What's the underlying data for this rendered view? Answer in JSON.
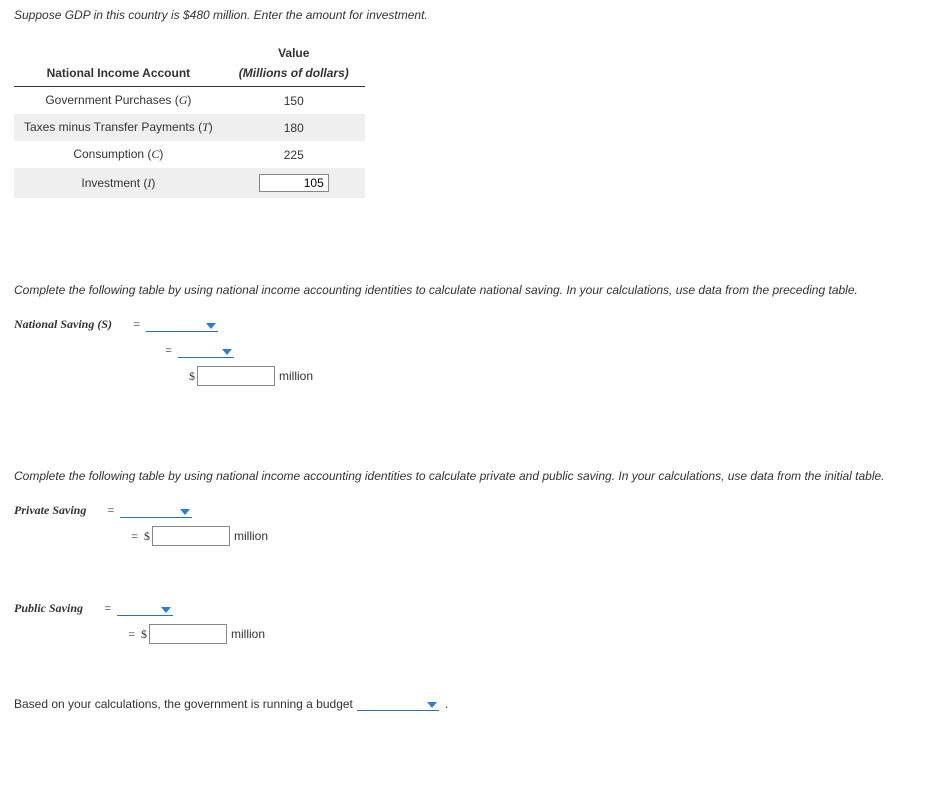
{
  "intro": "Suppose GDP in this country is $480 million. Enter the amount for investment.",
  "table": {
    "header_account": "National Income Account",
    "header_value_top": "Value",
    "header_value_sub": "(Millions of dollars)",
    "rows": [
      {
        "label": "Government Purchases (G)",
        "value": "150"
      },
      {
        "label": "Taxes minus Transfer Payments (T)",
        "value": "180"
      },
      {
        "label": "Consumption (C)",
        "value": "225"
      }
    ],
    "investment_label": "Investment (I)",
    "investment_value": "105"
  },
  "instr_national": "Complete the following table by using national income accounting identities to calculate national saving. In your calculations, use data from the preceding table.",
  "ns": {
    "label": "National Saving (S)",
    "eq": "=",
    "currency": "$",
    "unit": "million"
  },
  "instr_privpub": "Complete the following table by using national income accounting identities to calculate private and public saving. In your calculations, use data from the initial table.",
  "priv": {
    "label": "Private Saving",
    "eq": "=",
    "currency": "$",
    "unit": "million"
  },
  "pub": {
    "label": "Public Saving",
    "eq": "=",
    "currency": "$",
    "unit": "million"
  },
  "final": {
    "prefix": "Based on your calculations, the government is running a budget",
    "suffix": "."
  }
}
